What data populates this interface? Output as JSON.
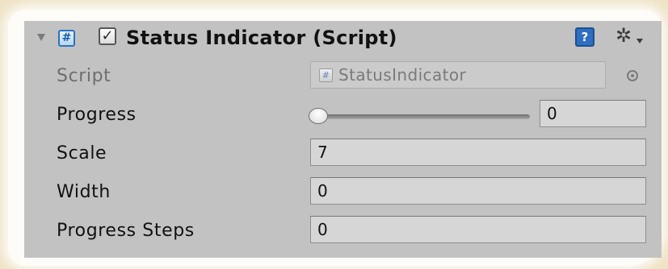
{
  "component": {
    "title": "Status Indicator (Script)",
    "enabled_check": "✓",
    "script_icon_glyph": "#",
    "help_icon_glyph": "?",
    "settings_icon_glyph": "✲"
  },
  "fields": {
    "script": {
      "label": "Script",
      "value": "StatusIndicator"
    },
    "progress": {
      "label": "Progress",
      "value": "0",
      "slider_fraction": 0
    },
    "scale": {
      "label": "Scale",
      "value": "7"
    },
    "width": {
      "label": "Width",
      "value": "0"
    },
    "progress_steps": {
      "label": "Progress Steps",
      "value": "0"
    }
  }
}
